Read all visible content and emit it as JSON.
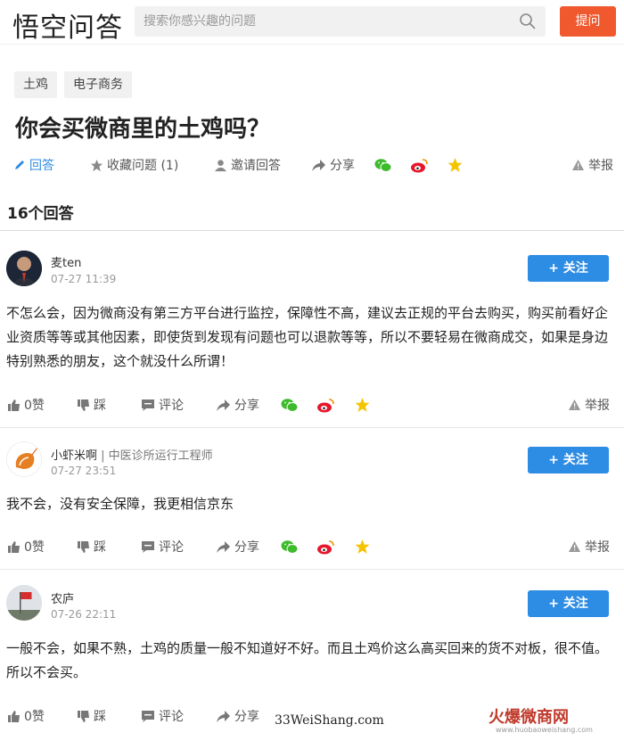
{
  "header": {
    "logo": "悟空问答",
    "search_placeholder": "搜索你感兴趣的问题",
    "ask_label": "提问"
  },
  "question": {
    "tags": [
      "土鸡",
      "电子商务"
    ],
    "title": "你会买微商里的土鸡吗？",
    "actions": {
      "answer": "回答",
      "favorite": "收藏问题 (1)",
      "invite": "邀请回答",
      "share": "分享",
      "report": "举报"
    }
  },
  "answers_count": "16个回答",
  "answers": [
    {
      "name": "麦ten",
      "title": "",
      "date": "07-27 11:39",
      "follow": "+ 关注",
      "text": "不怎么会，因为微商没有第三方平台进行监控，保障性不高，建议去正规的平台去购买，购买前看好企业资质等等或其他因素，即使货到发现有问题也可以退款等等，所以不要轻易在微商成交，如果是身边特别熟悉的朋友，这个就没什么所谓！",
      "like": "0赞",
      "dislike": "踩",
      "comment": "评论",
      "share": "分享",
      "report": "举报"
    },
    {
      "name": "小虾米啊",
      "title": "中医诊所运行工程师",
      "date": "07-27 23:51",
      "follow": "+ 关注",
      "text": "我不会，没有安全保障，我更相信京东",
      "like": "0赞",
      "dislike": "踩",
      "comment": "评论",
      "share": "分享",
      "report": "举报"
    },
    {
      "name": "农庐",
      "title": "",
      "date": "07-26 22:11",
      "follow": "+ 关注",
      "text": "一般不会，如果不熟，土鸡的质量一般不知道好不好。而且土鸡价这么高买回来的货不对板，很不值。所以不会买。",
      "like": "0赞",
      "dislike": "踩",
      "comment": "评论",
      "share": "分享",
      "report": ""
    }
  ],
  "watermarks": {
    "left": "33WeiShang.com",
    "right": "火爆微商网",
    "right_url": "www.huobaoweishang.com"
  },
  "colors": {
    "accent_orange": "#f0582e",
    "follow_blue": "#2d8ce3",
    "wechat_green": "#3dbb2c",
    "weibo_red": "#e6162d",
    "star_yellow": "#f5c400"
  }
}
